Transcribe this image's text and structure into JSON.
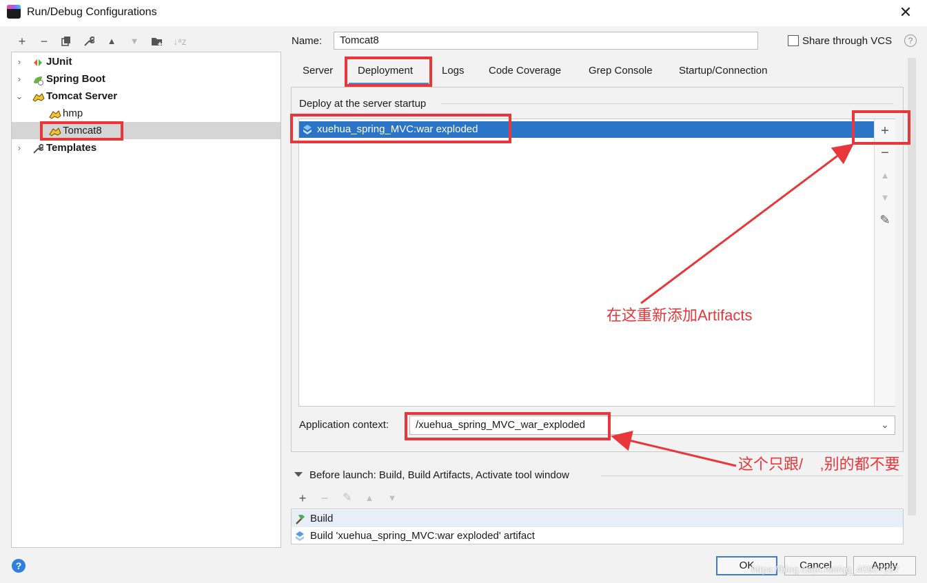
{
  "window": {
    "title": "Run/Debug Configurations"
  },
  "left_toolbar": {
    "icons": [
      "add-icon",
      "remove-icon",
      "copy-icon",
      "wrench-icon",
      "move-up-icon",
      "move-down-icon",
      "folder-add-icon",
      "sort-icon"
    ]
  },
  "tree": {
    "items": [
      {
        "label": "JUnit",
        "expanded": false,
        "bold": true,
        "icon": "junit-icon"
      },
      {
        "label": "Spring Boot",
        "expanded": false,
        "bold": true,
        "icon": "spring-boot-icon"
      },
      {
        "label": "Tomcat Server",
        "expanded": true,
        "bold": true,
        "icon": "tomcat-icon"
      },
      {
        "label": "hmp",
        "child": true,
        "icon": "tomcat-icon"
      },
      {
        "label": "Tomcat8",
        "child": true,
        "selected": true,
        "icon": "tomcat-icon"
      },
      {
        "label": "Templates",
        "expanded": false,
        "bold": true,
        "icon": "wrench-icon"
      }
    ]
  },
  "config": {
    "name_label": "Name:",
    "name_value": "Tomcat8",
    "share_label": "Share through VCS",
    "share_checked": false,
    "help": "?"
  },
  "tabs": [
    "Server",
    "Deployment",
    "Logs",
    "Code Coverage",
    "Grep Console",
    "Startup/Connection"
  ],
  "active_tab": "Deployment",
  "deploy": {
    "section_label": "Deploy at the server startup",
    "artifacts": [
      "xuehua_spring_MVC:war exploded"
    ],
    "side_buttons": {
      "add": "+",
      "remove": "−",
      "up": "▲",
      "down": "▼",
      "edit": "✎"
    }
  },
  "context": {
    "label": "Application context:",
    "value": "/xuehua_spring_MVC_war_exploded"
  },
  "before_launch": {
    "label": "Before launch: Build, Build Artifacts, Activate tool window",
    "tasks": [
      "Build",
      "Build 'xuehua_spring_MVC:war exploded' artifact"
    ]
  },
  "buttons": {
    "ok": "OK",
    "cancel": "Cancel",
    "apply": "Apply",
    "help": "?"
  },
  "annotations": {
    "add_artifacts_note": "在这重新添加Artifacts",
    "context_note": "这个只跟/    ,别的都不要"
  },
  "watermark": "https://blog.csdn.net/qq_40907287",
  "colors": {
    "annotation_red": "#e8363a",
    "selection_blue": "#2b74c6",
    "ok_border": "#3a7bd5"
  }
}
